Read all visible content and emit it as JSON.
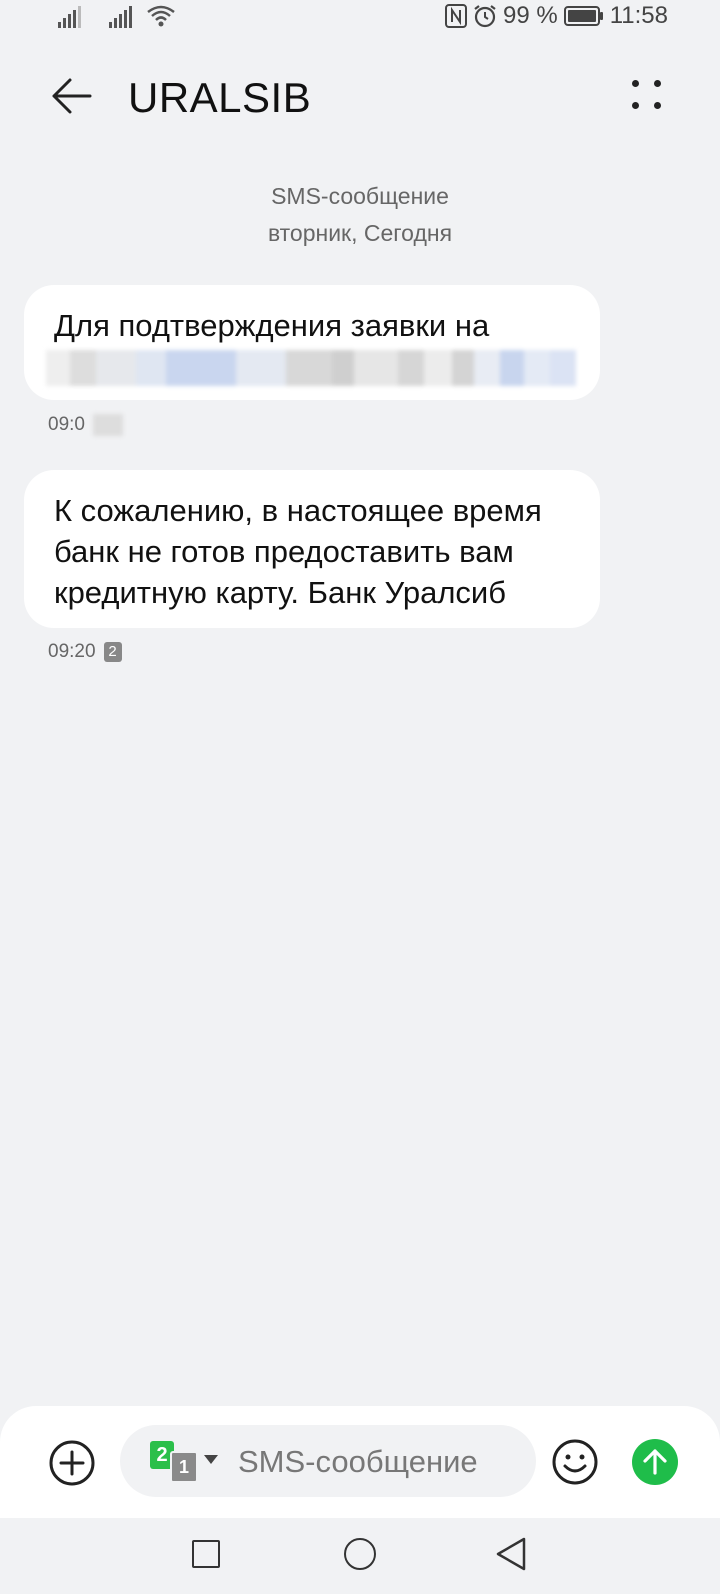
{
  "status_bar": {
    "battery_percent": "99 %",
    "time": "11:58",
    "icons": [
      "signal-icon",
      "signal-icon",
      "wifi-icon",
      "nfc-icon",
      "alarm-icon",
      "battery-icon"
    ]
  },
  "header": {
    "title": "URALSIB",
    "back_icon": "arrow-left-icon",
    "more_icon": "more-icon"
  },
  "conversation": {
    "message_type": "SMS-сообщение",
    "date": "вторник, Сегодня",
    "messages": [
      {
        "text": "Для подтверждения заявки на",
        "time": "09:0",
        "redacted": true
      },
      {
        "text": "К сожалению, в настоящее время банк не готов предоставить вам кредитную карту. Банк Уралсиб",
        "time": "09:20",
        "sim": "2"
      }
    ]
  },
  "composer": {
    "placeholder": "SMS-сообщение",
    "sim_primary": "2",
    "sim_secondary": "1",
    "icons": [
      "add-icon",
      "sim-icon",
      "emoji-icon",
      "send-icon"
    ],
    "send_color": "#1fbd4a"
  },
  "navbar": {
    "icons": [
      "recents-icon",
      "home-icon",
      "back-icon"
    ]
  }
}
